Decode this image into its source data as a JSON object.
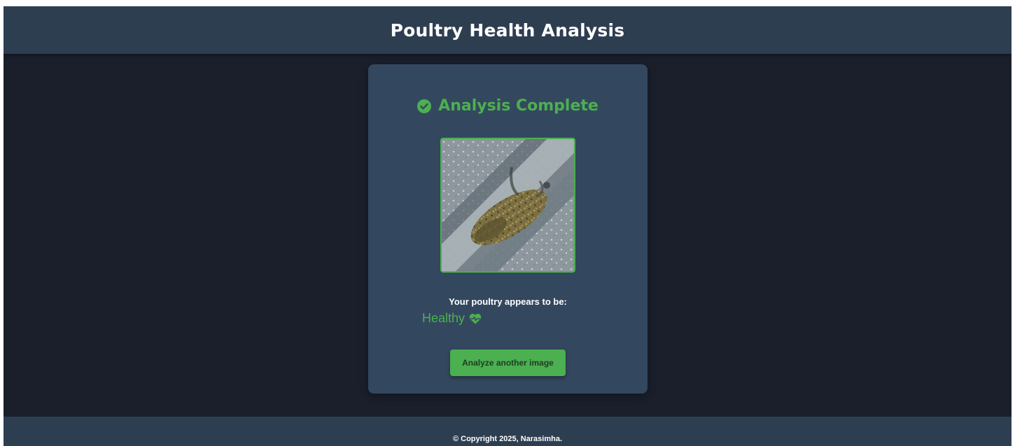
{
  "header": {
    "title": "Poultry Health Analysis"
  },
  "card": {
    "status_icon": "check-circle-icon",
    "status_text": "Analysis Complete",
    "image_icon": "poultry-photo",
    "result_label": "Your poultry appears to be:",
    "result_value": "Healthy",
    "result_icon": "heart-pulse-icon",
    "button_label": "Analyze another image"
  },
  "footer": {
    "copyright": "© Copyright 2025, Narasimha."
  },
  "colors": {
    "accent": "#4caf50",
    "background": "#1a1f2b",
    "surface": "#33485f",
    "header": "#2e3e51"
  }
}
